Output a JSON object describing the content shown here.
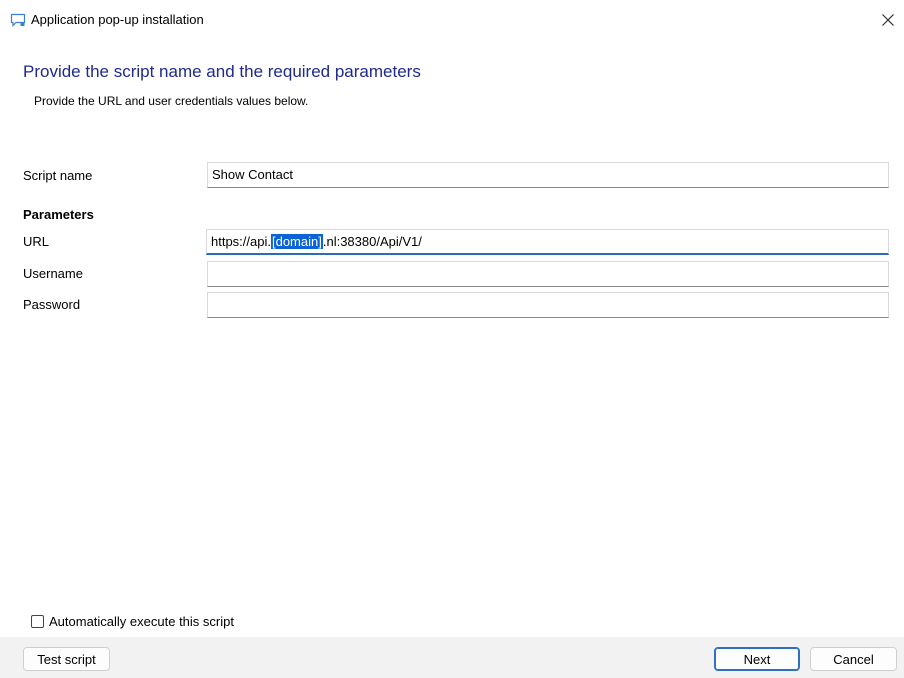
{
  "window": {
    "title": "Application pop-up installation",
    "close_icon": "close-icon"
  },
  "header": {
    "heading": "Provide the script name and the required parameters",
    "subheading": "Provide the URL and user credentials values below."
  },
  "form": {
    "script_name_label": "Script name",
    "script_name_value": "Show Contact",
    "parameters_label": "Parameters",
    "url_label": "URL",
    "url_prefix": "https://api.",
    "url_selected": "[domain]",
    "url_suffix": ".nl:38380/Api/V1/",
    "username_label": "Username",
    "username_value": "",
    "password_label": "Password",
    "password_value": ""
  },
  "options": {
    "auto_execute_label": "Automatically execute this script",
    "auto_execute_checked": false
  },
  "footer": {
    "test_script_label": "Test script",
    "next_label": "Next",
    "cancel_label": "Cancel"
  },
  "colors": {
    "heading": "#1f2a8a",
    "focus_accent": "#2b6cb6",
    "selection": "#0a64d8"
  }
}
